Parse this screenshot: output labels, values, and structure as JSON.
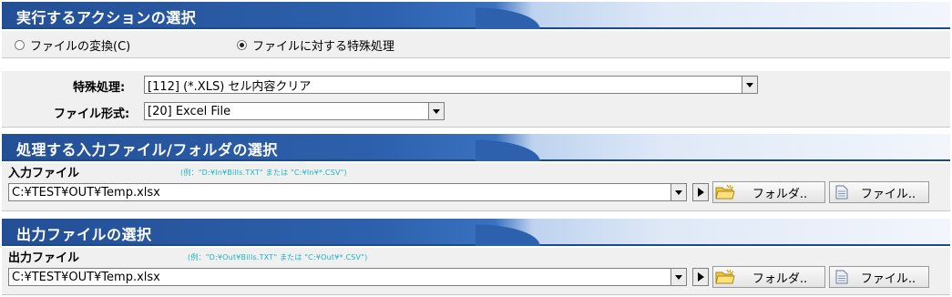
{
  "section_action": {
    "title": "実行するアクションの選択",
    "options": [
      {
        "label": "ファイルの変換(C)",
        "checked": false
      },
      {
        "label": "ファイルに対する特殊処理",
        "checked": true
      }
    ]
  },
  "settings": {
    "special_label": "特殊処理:",
    "special_value": "[112] (*.XLS) セル内容クリア",
    "format_label": "ファイル形式:",
    "format_value": "[20] Excel File"
  },
  "section_input": {
    "title": "処理する入力ファイル/フォルダの選択",
    "label": "入力ファイル",
    "hint": "(例：\"D:¥In¥Bills.TXT\" または \"C:¥In¥*.CSV\")",
    "path": "C:¥TEST¥OUT¥Temp.xlsx",
    "folder_button": "フォルダ..",
    "file_button": "ファイル.."
  },
  "section_output": {
    "title": "出力ファイルの選択",
    "label": "出力ファイル",
    "hint": "(例：\"D:¥Out¥Bills.TXT\" または \"C:¥Out¥*.CSV\")",
    "path": "C:¥TEST¥OUT¥Temp.xlsx",
    "folder_button": "フォルダ..",
    "file_button": "ファイル.."
  },
  "colors": {
    "header_blue": "#2d61ad",
    "hint_cyan": "#19b6c4",
    "panel_gray": "#f0f0f0"
  }
}
